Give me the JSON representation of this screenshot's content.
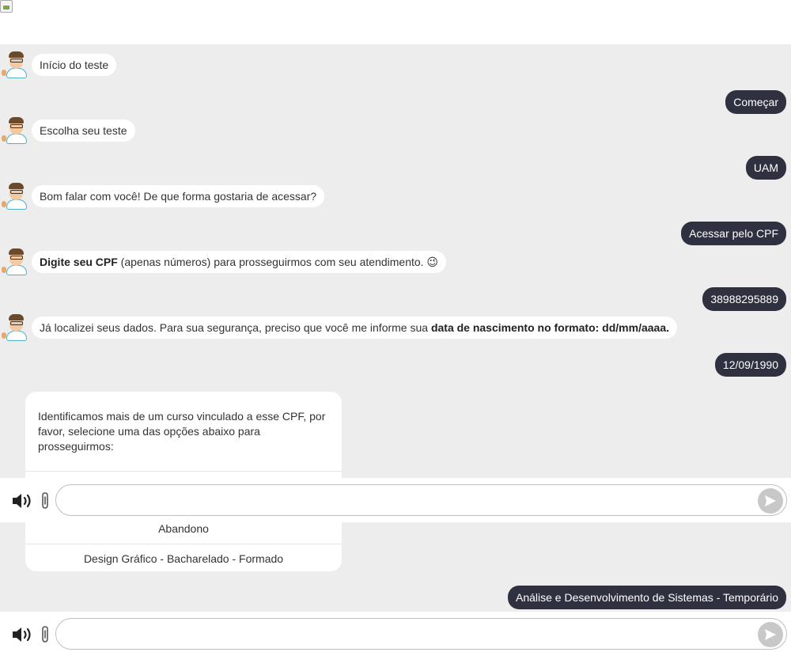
{
  "messages": [
    {
      "from": "bot",
      "parts": [
        {
          "text": "Início do teste"
        }
      ]
    },
    {
      "from": "user",
      "text": "Começar"
    },
    {
      "from": "bot",
      "parts": [
        {
          "text": "Escolha seu teste"
        }
      ]
    },
    {
      "from": "user",
      "text": "UAM"
    },
    {
      "from": "bot",
      "parts": [
        {
          "text": "Bom falar com você! De que forma gostaria de acessar?"
        }
      ]
    },
    {
      "from": "user",
      "text": "Acessar pelo CPF"
    },
    {
      "from": "bot",
      "parts": [
        {
          "text": "Digite seu CPF",
          "bold": true
        },
        {
          "text": " (apenas números) para prosseguirmos com seu atendimento. 😉"
        }
      ]
    },
    {
      "from": "user",
      "text": "38988295889"
    },
    {
      "from": "bot",
      "parts": [
        {
          "text": "Já localizei seus dados. Para sua segurança, preciso que você me informe sua "
        },
        {
          "text": "data de nascimento no formato: dd/mm/aaaa.",
          "bold": true
        }
      ]
    },
    {
      "from": "user",
      "text": "12/09/1990"
    },
    {
      "from": "user",
      "text": "Análise e Desenvolvimento de Sistemas - Temporário"
    }
  ],
  "options_card": {
    "text": "Identificamos mais de um curso vinculado a esse CPF, por favor, selecione uma das opções abaixo para prosseguirmos:",
    "options": [
      "Abandono",
      "Design Gráfico - Bacharelado - Formado"
    ]
  },
  "input": {
    "value": "",
    "placeholder": ""
  },
  "icons": {
    "speaker": "speaker-icon",
    "attach": "paperclip-icon",
    "send": "send-icon",
    "avatar": "bot-avatar"
  },
  "colors": {
    "chat_bg": "#ededed",
    "user_bubble": "#2f3140",
    "send_button": "#c8c8c8"
  }
}
